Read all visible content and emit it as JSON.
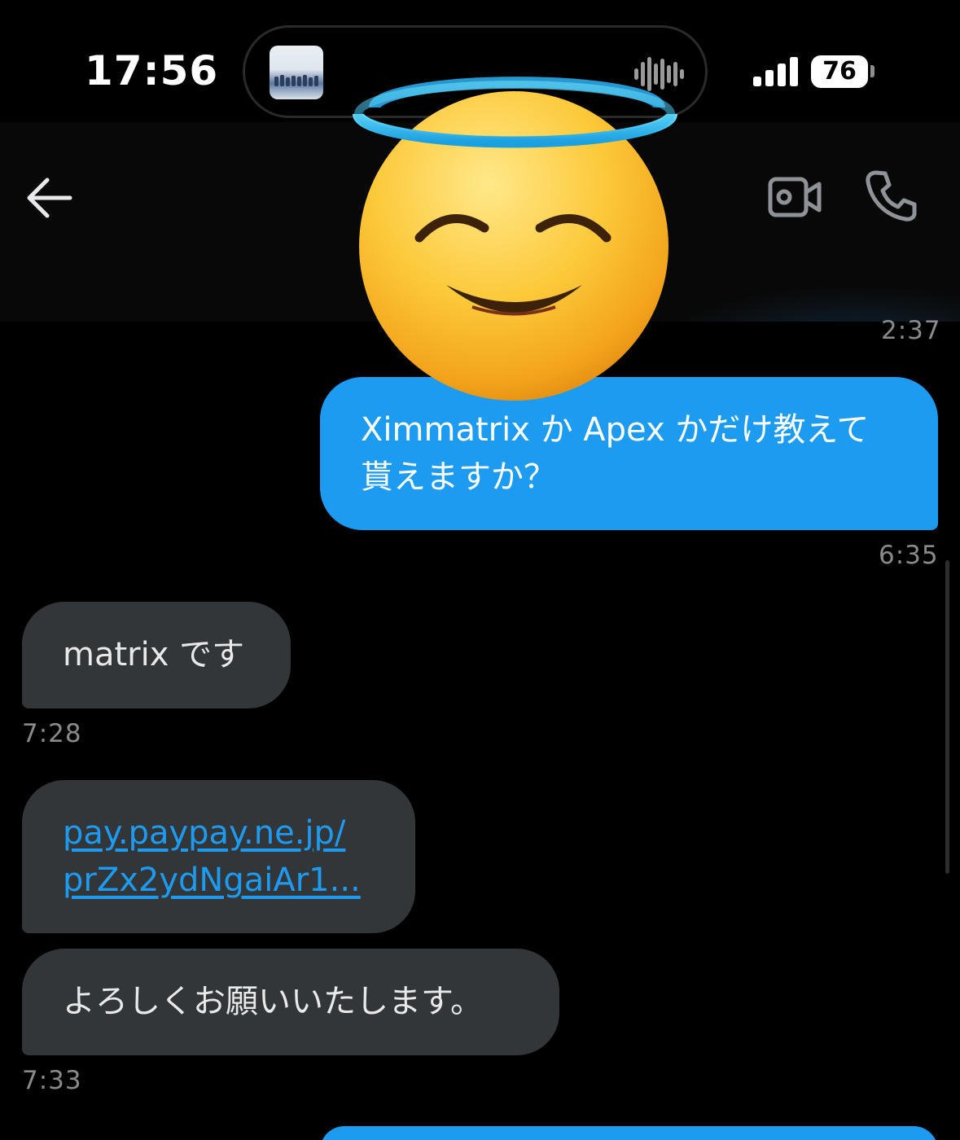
{
  "status_bar": {
    "time": "17:56",
    "battery_level": "76"
  },
  "header": {
    "back_icon": "arrow-left-icon",
    "video_icon": "video-camera-icon",
    "call_icon": "phone-icon"
  },
  "overlay": {
    "emoji": "smiling-face-with-halo"
  },
  "messages": [
    {
      "time": "2:37"
    },
    {
      "direction": "outgoing",
      "line1": "Ximmatrix か Apex かだけ教えて",
      "line2": "貰えますか？",
      "time": "6:35"
    },
    {
      "direction": "incoming",
      "text": "matrix です",
      "time": "7:28"
    },
    {
      "direction": "incoming",
      "link_line1": "pay.paypay.ne.jp/",
      "link_line2": "prZx2ydNgaiAr1..."
    },
    {
      "direction": "incoming",
      "text": "よろしくお願いいたします。",
      "time": "7:33"
    },
    {
      "direction": "outgoing",
      "text": ""
    }
  ],
  "colors": {
    "outgoing_bubble": "#1d9bf0",
    "incoming_bubble": "#333639",
    "link": "#1d9bf0",
    "background": "#000000"
  }
}
